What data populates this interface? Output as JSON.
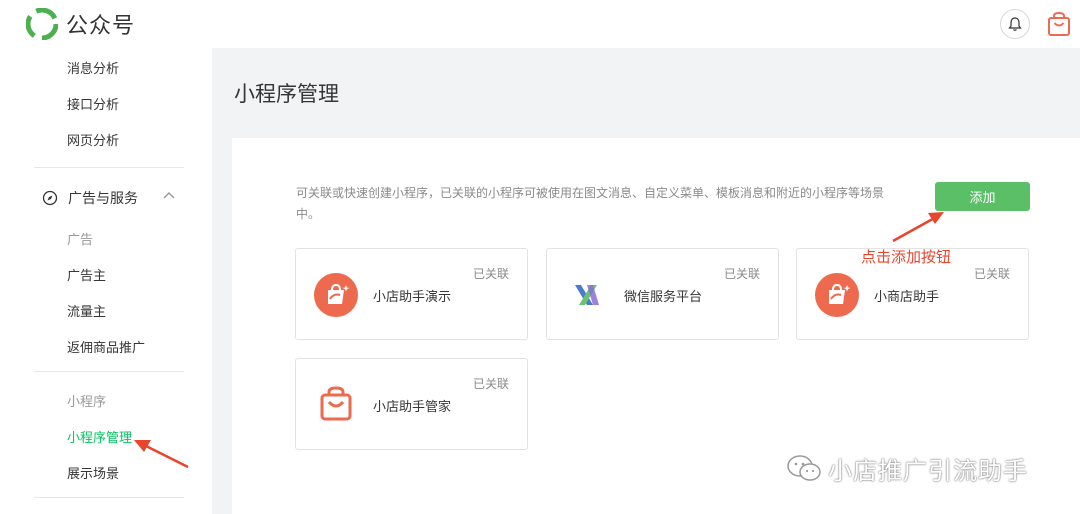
{
  "header": {
    "logo_text": "公众号"
  },
  "sidebar": {
    "items_top": [
      "消息分析",
      "接口分析",
      "网页分析"
    ],
    "group_label": "广告与服务",
    "sub_section": "广告",
    "ad_items": [
      "广告主",
      "流量主",
      "返佣商品推广"
    ],
    "mini_section": "小程序",
    "mini_items": [
      "小程序管理",
      "展示场景"
    ]
  },
  "main": {
    "title": "小程序管理",
    "description": "可关联或快速创建小程序，已关联的小程序可被使用在图文消息、自定义菜单、模板消息和附近的小程序等场景中。",
    "add_button": "添加",
    "cards": [
      {
        "name": "小店助手演示",
        "status": "已关联",
        "icon": "shop-bag-icon"
      },
      {
        "name": "微信服务平台",
        "status": "已关联",
        "icon": "wechat-service-icon"
      },
      {
        "name": "小商店助手",
        "status": "已关联",
        "icon": "shop-bag-icon"
      },
      {
        "name": "小店助手管家",
        "status": "已关联",
        "icon": "shopping-bag-outline-icon"
      }
    ]
  },
  "annotation": {
    "text": "点击添加按钮"
  },
  "watermark": {
    "text": "小店推广引流助手"
  },
  "colors": {
    "accent_green": "#07c160",
    "button_green": "#5bbf68",
    "annotation_red": "#e8452c",
    "icon_orange": "#ee6a4e"
  }
}
